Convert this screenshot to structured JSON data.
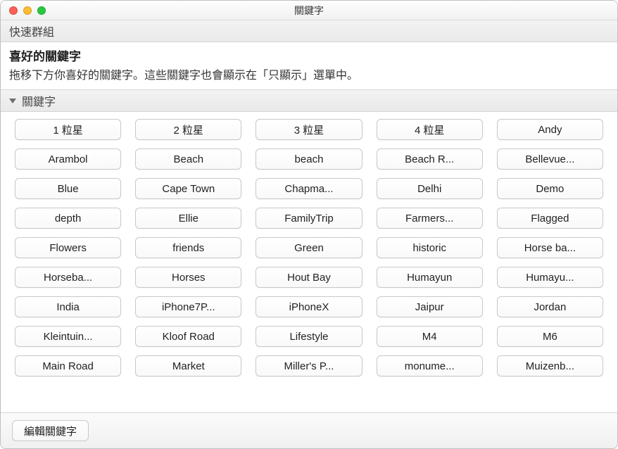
{
  "window": {
    "title": "關鍵字"
  },
  "sections": {
    "quick_group": "快速群組",
    "favorites_title": "喜好的關鍵字",
    "favorites_desc": "拖移下方你喜好的關鍵字。這些關鍵字也會顯示在「只顯示」選單中。",
    "keywords_header": "關鍵字"
  },
  "keywords": [
    "1 粒星",
    "2 粒星",
    "3 粒星",
    "4 粒星",
    "Andy",
    "Arambol",
    "Beach",
    "beach",
    "Beach R...",
    "Bellevue...",
    "Blue",
    "Cape Town",
    "Chapma...",
    "Delhi",
    "Demo",
    "depth",
    "Ellie",
    "FamilyTrip",
    "Farmers...",
    "Flagged",
    "Flowers",
    "friends",
    "Green",
    "historic",
    "Horse ba...",
    "Horseba...",
    "Horses",
    "Hout Bay",
    "Humayun",
    "Humayu...",
    "India",
    "iPhone7P...",
    "iPhoneX",
    "Jaipur",
    "Jordan",
    "Kleintuin...",
    "Kloof Road",
    "Lifestyle",
    "M4",
    "M6",
    "Main Road",
    "Market",
    "Miller's P...",
    "monume...",
    "Muizenb..."
  ],
  "footer": {
    "edit_label": "編輯關鍵字"
  }
}
